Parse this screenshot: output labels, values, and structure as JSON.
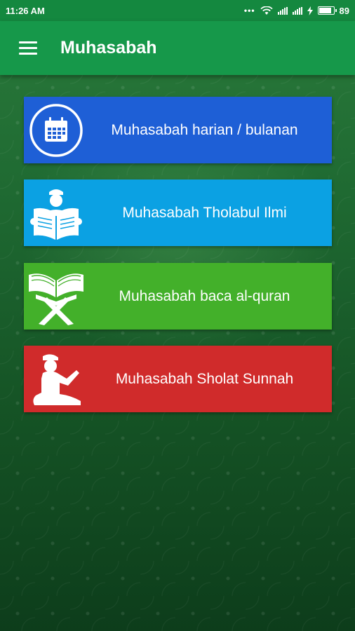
{
  "status_bar": {
    "time": "11:26 AM",
    "battery_level": "89"
  },
  "app_bar": {
    "title": "Muhasabah",
    "menu_icon": "hamburger-menu-icon"
  },
  "menu": {
    "items": [
      {
        "label": "Muhasabah harian / bulanan",
        "icon": "calendar-icon",
        "color": "#1e5fd6"
      },
      {
        "label": "Muhasabah Tholabul Ilmi",
        "icon": "reading-student-icon",
        "color": "#0ba1e3"
      },
      {
        "label": "Muhasabah baca al-quran",
        "icon": "quran-stand-icon",
        "color": "#43b02a"
      },
      {
        "label": "Muhasabah Sholat Sunnah",
        "icon": "praying-person-icon",
        "color": "#d02b2b"
      }
    ]
  },
  "colors": {
    "status_bar": "#14883f",
    "app_bar": "#16984a",
    "background": "#1f6a32"
  }
}
